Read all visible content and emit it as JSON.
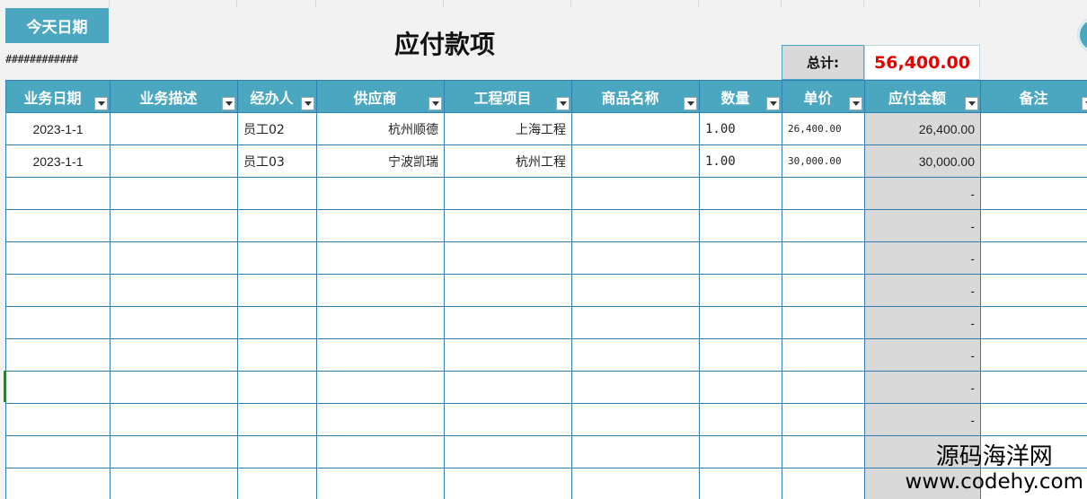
{
  "toolbar": {
    "today_button_label": "今天日期",
    "today_cell_value": "############"
  },
  "title": "应付款项",
  "summary": {
    "total_label": "总计:",
    "total_value": "56,400.00"
  },
  "colors": {
    "header_bg": "#4aa7bf",
    "total_value_color": "#e60000",
    "amount_column_bg": "#d9d9d9",
    "grid_line": "#2f7fb3"
  },
  "table": {
    "headers": [
      "业务日期",
      "业务描述",
      "经办人",
      "供应商",
      "工程项目",
      "商品名称",
      "数量",
      "单价",
      "应付金额",
      "备注"
    ],
    "rows": [
      {
        "date": "2023-1-1",
        "desc": "",
        "handler": "员工02",
        "supplier": "杭州顺德",
        "project": "上海工程",
        "product": "",
        "qty": "1.00",
        "price": "26,400.00",
        "amount": "26,400.00",
        "note": ""
      },
      {
        "date": "2023-1-1",
        "desc": "",
        "handler": "员工03",
        "supplier": "宁波凯瑞",
        "project": "杭州工程",
        "product": "",
        "qty": "1.00",
        "price": "30,000.00",
        "amount": "30,000.00",
        "note": ""
      },
      {
        "date": "",
        "desc": "",
        "handler": "",
        "supplier": "",
        "project": "",
        "product": "",
        "qty": "",
        "price": "",
        "amount": "-",
        "note": ""
      },
      {
        "date": "",
        "desc": "",
        "handler": "",
        "supplier": "",
        "project": "",
        "product": "",
        "qty": "",
        "price": "",
        "amount": "-",
        "note": ""
      },
      {
        "date": "",
        "desc": "",
        "handler": "",
        "supplier": "",
        "project": "",
        "product": "",
        "qty": "",
        "price": "",
        "amount": "-",
        "note": ""
      },
      {
        "date": "",
        "desc": "",
        "handler": "",
        "supplier": "",
        "project": "",
        "product": "",
        "qty": "",
        "price": "",
        "amount": "-",
        "note": ""
      },
      {
        "date": "",
        "desc": "",
        "handler": "",
        "supplier": "",
        "project": "",
        "product": "",
        "qty": "",
        "price": "",
        "amount": "-",
        "note": ""
      },
      {
        "date": "",
        "desc": "",
        "handler": "",
        "supplier": "",
        "project": "",
        "product": "",
        "qty": "",
        "price": "",
        "amount": "-",
        "note": ""
      },
      {
        "date": "",
        "desc": "",
        "handler": "",
        "supplier": "",
        "project": "",
        "product": "",
        "qty": "",
        "price": "",
        "amount": "-",
        "note": ""
      },
      {
        "date": "",
        "desc": "",
        "handler": "",
        "supplier": "",
        "project": "",
        "product": "",
        "qty": "",
        "price": "",
        "amount": "-",
        "note": ""
      },
      {
        "date": "",
        "desc": "",
        "handler": "",
        "supplier": "",
        "project": "",
        "product": "",
        "qty": "",
        "price": "",
        "amount": "",
        "note": ""
      },
      {
        "date": "",
        "desc": "",
        "handler": "",
        "supplier": "",
        "project": "",
        "product": "",
        "qty": "",
        "price": "",
        "amount": "",
        "note": ""
      }
    ]
  },
  "watermark": {
    "line1": "源码海洋网",
    "line2": "www.codehy.com"
  }
}
